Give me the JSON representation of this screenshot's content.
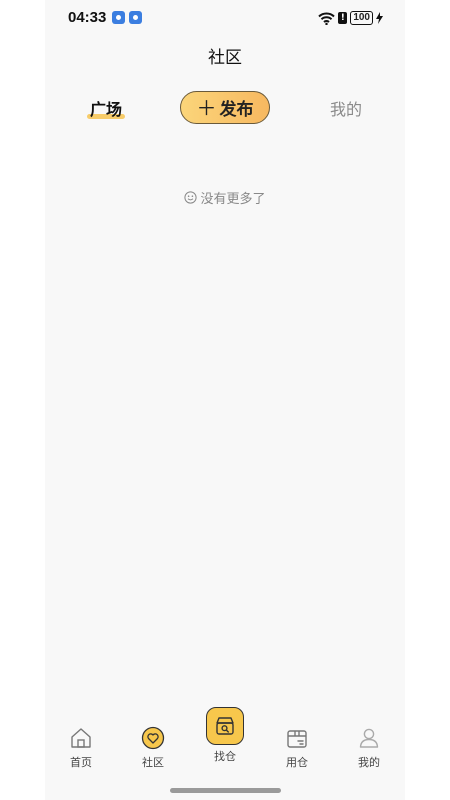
{
  "status_bar": {
    "time": "04:33",
    "battery": "100"
  },
  "header": {
    "title": "社区"
  },
  "tabs": {
    "plaza": "广场",
    "publish": "发布",
    "mine": "我的"
  },
  "feed": {
    "empty_text": "没有更多了"
  },
  "bottom_nav": {
    "items": [
      {
        "label": "首页",
        "icon": "home-icon"
      },
      {
        "label": "社区",
        "icon": "heart-icon"
      },
      {
        "label": "找仓",
        "icon": "warehouse-search-icon"
      },
      {
        "label": "用仓",
        "icon": "box-icon"
      },
      {
        "label": "我的",
        "icon": "person-icon"
      }
    ]
  },
  "colors": {
    "accent": "#f7c74c",
    "background": "#f8f8f8"
  }
}
